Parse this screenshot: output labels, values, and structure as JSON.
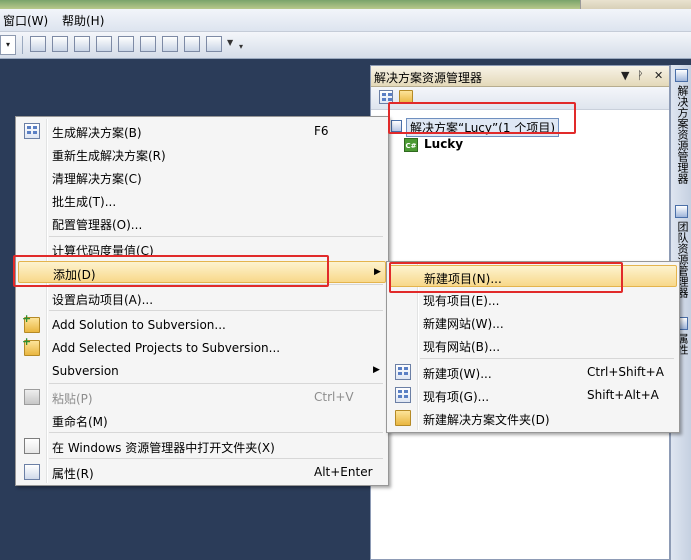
{
  "menubar": {
    "items": [
      "窗口(W)",
      "帮助(H)"
    ]
  },
  "toolbar": {
    "icons": [
      "find-icon",
      "properties-icon",
      "class-view-icon",
      "object-browser-icon",
      "toolbox-icon",
      "tools-icon",
      "start-page-icon",
      "command-window-icon",
      "display-icon"
    ]
  },
  "solution_explorer": {
    "title": "解决方案资源管理器",
    "title_buttons": [
      "▼",
      "ᚹ",
      "✕"
    ],
    "solution_label": "解决方案“Lucy”(1 个项目)",
    "project_label": "Lucky",
    "project_icon_text": "C#"
  },
  "side_tabs": [
    "解决方案资源管理器",
    "团队资源管理器",
    "属性"
  ],
  "context_menu": {
    "items": [
      {
        "label": "生成解决方案(B)",
        "shortcut": "F6",
        "icon": "build-icon"
      },
      {
        "label": "重新生成解决方案(R)",
        "shortcut": ""
      },
      {
        "label": "清理解决方案(C)",
        "shortcut": ""
      },
      {
        "label": "批生成(T)...",
        "shortcut": ""
      },
      {
        "label": "配置管理器(O)...",
        "shortcut": ""
      },
      {
        "label": "计算代码度量值(C)",
        "shortcut": ""
      },
      {
        "label": "添加(D)",
        "shortcut": "",
        "submenu": true,
        "highlighted": true
      },
      {
        "label": "设置启动项目(A)...",
        "shortcut": ""
      },
      {
        "label": "Add Solution to Subversion...",
        "shortcut": "",
        "icon": "add-folder-icon"
      },
      {
        "label": "Add Selected Projects to Subversion...",
        "shortcut": "",
        "icon": "add-folder-icon"
      },
      {
        "label": "Subversion",
        "shortcut": "",
        "submenu": true
      },
      {
        "label": "粘贴(P)",
        "shortcut": "Ctrl+V",
        "disabled": true,
        "icon": "paste-icon"
      },
      {
        "label": "重命名(M)",
        "shortcut": ""
      },
      {
        "label": "在 Windows 资源管理器中打开文件夹(X)",
        "shortcut": "",
        "icon": "open-folder-icon"
      },
      {
        "label": "属性(R)",
        "shortcut": "Alt+Enter",
        "icon": "properties-icon"
      }
    ]
  },
  "add_submenu": {
    "items": [
      {
        "label": "新建项目(N)...",
        "shortcut": "",
        "highlighted": true
      },
      {
        "label": "现有项目(E)...",
        "shortcut": ""
      },
      {
        "label": "新建网站(W)...",
        "shortcut": ""
      },
      {
        "label": "现有网站(B)...",
        "shortcut": ""
      },
      {
        "label": "新建项(W)...",
        "shortcut": "Ctrl+Shift+A",
        "icon": "new-item-icon"
      },
      {
        "label": "现有项(G)...",
        "shortcut": "Shift+Alt+A",
        "icon": "existing-item-icon"
      },
      {
        "label": "新建解决方案文件夹(D)",
        "shortcut": "",
        "icon": "new-folder-icon"
      }
    ]
  },
  "colors": {
    "background": "#2b3c59",
    "highlight": "#f8d88a",
    "annotation": "#e12a2a"
  }
}
